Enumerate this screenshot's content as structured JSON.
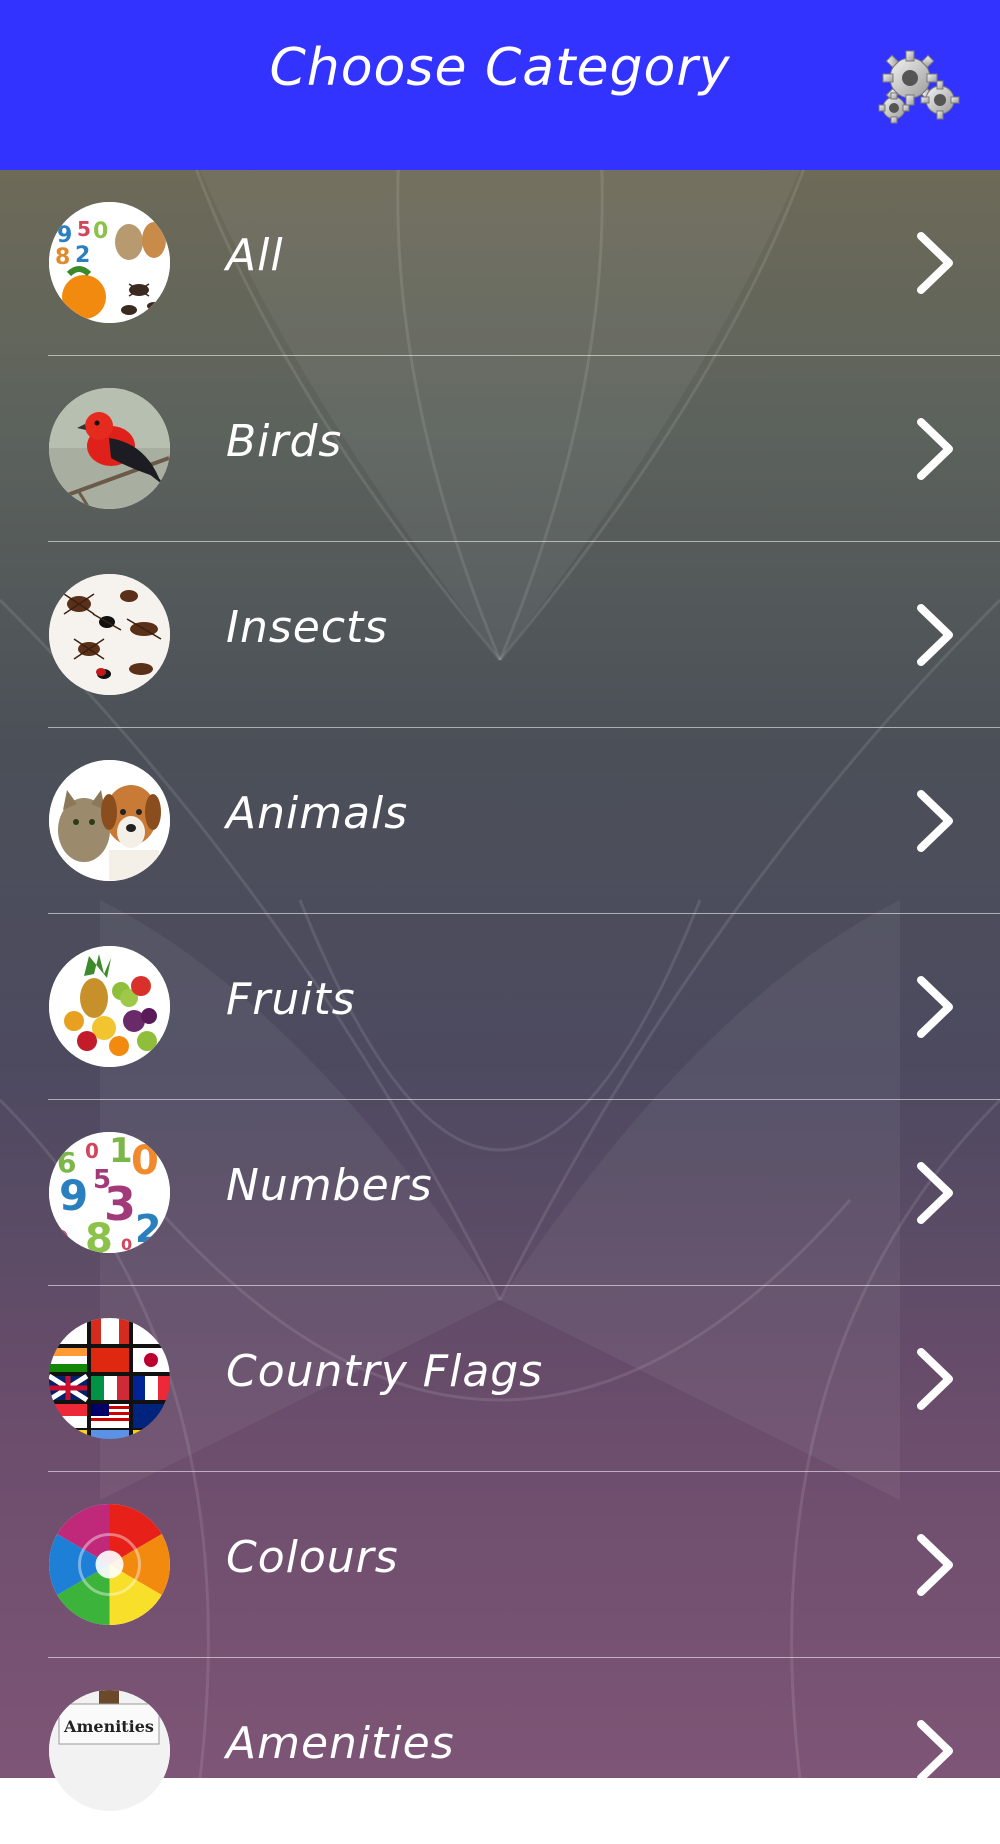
{
  "header": {
    "title": "Choose Category",
    "settings_icon": "gears-icon",
    "background": "#3333ff"
  },
  "categories": [
    {
      "label": "All",
      "thumb": "collage-icon"
    },
    {
      "label": "Birds",
      "thumb": "bird-icon"
    },
    {
      "label": "Insects",
      "thumb": "insects-icon"
    },
    {
      "label": "Animals",
      "thumb": "cat-dog-icon"
    },
    {
      "label": "Fruits",
      "thumb": "fruits-icon"
    },
    {
      "label": "Numbers",
      "thumb": "numbers-icon"
    },
    {
      "label": "Country Flags",
      "thumb": "flags-icon"
    },
    {
      "label": "Colours",
      "thumb": "color-swirl-icon"
    },
    {
      "label": "Amenities",
      "thumb": "amenities-sign-icon"
    }
  ],
  "thumb_texts": {
    "all_digits": "9530 82",
    "numbers_digits": "6 0 1 0 5 9 3 0 8 2 0",
    "amenities_sign": "Amenities"
  }
}
